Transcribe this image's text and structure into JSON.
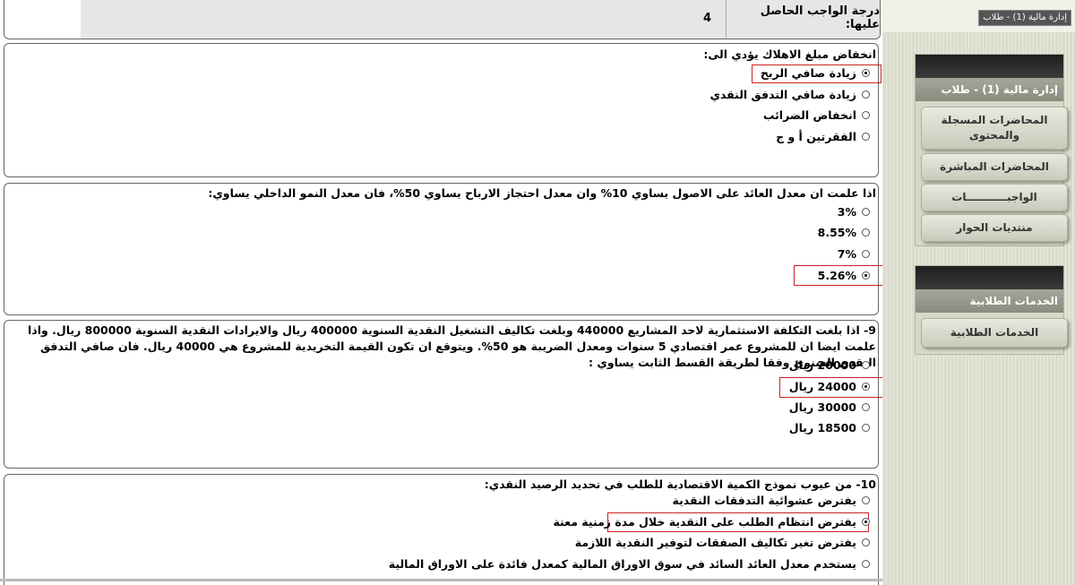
{
  "grade": {
    "label": "درجة الواجب الحاصل عليها:",
    "value": "4"
  },
  "questions": [
    {
      "text": "انخفاض مبلغ الاهلاك يؤدي الى:",
      "options": [
        "زيادة صافي الربح",
        "زيادة صافي التدفق النقدي",
        "انخفاض الضرائب",
        "الفقرتين أ و ج"
      ],
      "selected_index": 0
    },
    {
      "text": "اذا علمت ان معدل العائد على الاصول يساوي 10% وان معدل احتجاز الارباح يساوي 50%، فان معدل النمو الداخلي يساوي:",
      "options": [
        "3%",
        "8.55%",
        "7%",
        "5.26%"
      ],
      "selected_index": 3
    },
    {
      "text": "9- اذا بلغت التكلفة الاستثمارية لاحد المشاريع 440000 وبلغت تكاليف التشغيل النقدية السنوية 400000 ريال والايرادات النقدية السنوية 800000 ريال. واذا علمت ايضا ان للمشروع عمر اقتصادي 5 سنوات ومعدل الضريبة هو 50%. ويتوقع ان تكون القيمة التخريدية للمشروع هي 40000 ريال. فان صافي التدفق النقدي السنوي وفقا لطريقة القسط الثابت يساوي :",
      "options": [
        "20000 ريال",
        "24000 ريال",
        "30000 ريال",
        "18500 ريال"
      ],
      "selected_index": 1
    },
    {
      "text": "10- من عيوب نموذج الكمية الاقتصادية للطلب في تحديد الرصيد النقدي:",
      "options": [
        "يفترض عشوائية التدفقات النقدية",
        "يفترض انتظام الطلب على النقدية خلال مدة زمنية معنة",
        "يفترض تغير تكاليف الصفقات لتوفير النقدية اللازمة",
        "يستخدم معدل العائد السائد في سوق الاوراق المالية كمعدل فائدة على الاوراق المالية"
      ],
      "selected_index": 1
    }
  ],
  "sidebar": {
    "course_chip": "إدارة مالية (1) - طلاب",
    "course_panel": {
      "title": "إدارة مالية (1) - طلاب",
      "buttons": [
        "المحاضرات المسجلة والمحتوى",
        "المحاضرات المباشرة",
        "الواجبـــــــــــات",
        "منتديات الحوار"
      ]
    },
    "services_panel": {
      "title": "الخدمات الطلابية",
      "buttons": [
        "الخدمات الطلابية"
      ]
    }
  },
  "colors": {
    "highlight": "#cc2222",
    "sidebar_bg": "#dcdccd",
    "grade_bg": "#e6e6e6"
  }
}
